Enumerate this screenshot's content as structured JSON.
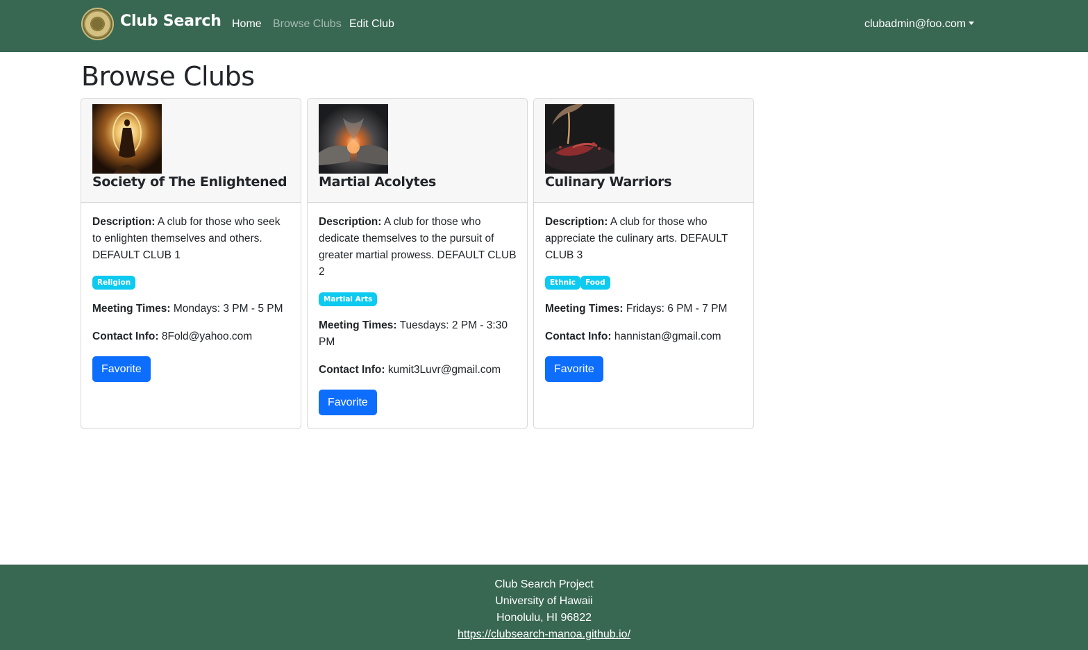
{
  "navbar": {
    "brand": "Club Search",
    "links": [
      {
        "label": "Home"
      },
      {
        "label": "Browse Clubs"
      },
      {
        "label": "Edit Club"
      }
    ],
    "user": "clubadmin@foo.com"
  },
  "page": {
    "title": "Browse Clubs"
  },
  "labels": {
    "description": "Description:",
    "meeting": "Meeting Times:",
    "contact": "Contact Info:",
    "favorite": "Favorite"
  },
  "clubs": [
    {
      "name": "Society of The Enlightened",
      "description": "A club for those who seek to enlighten themselves and others. DEFAULT CLUB 1",
      "tags": [
        "Religion"
      ],
      "meeting": "Mondays: 3 PM - 5 PM",
      "contact": "8Fold@yahoo.com"
    },
    {
      "name": "Martial Acolytes",
      "description": "A club for those who dedicate themselves to the pursuit of greater martial prowess. DEFAULT CLUB 2",
      "tags": [
        "Martial Arts"
      ],
      "meeting": "Tuesdays: 2 PM - 3:30 PM",
      "contact": "kumit3Luvr@gmail.com"
    },
    {
      "name": "Culinary Warriors",
      "description": "A club for those who appreciate the culinary arts. DEFAULT CLUB 3",
      "tags": [
        "Ethnic",
        "Food"
      ],
      "meeting": "Fridays: 6 PM - 7 PM",
      "contact": "hannistan@gmail.com"
    }
  ],
  "footer": {
    "line1": "Club Search Project",
    "line2": "University of Hawaii",
    "line3": "Honolulu, HI 96822",
    "link": "https://clubsearch-manoa.github.io/"
  },
  "colors": {
    "navbar": "#386752",
    "badge": "#0dcaf0",
    "button": "#0d6efd"
  }
}
